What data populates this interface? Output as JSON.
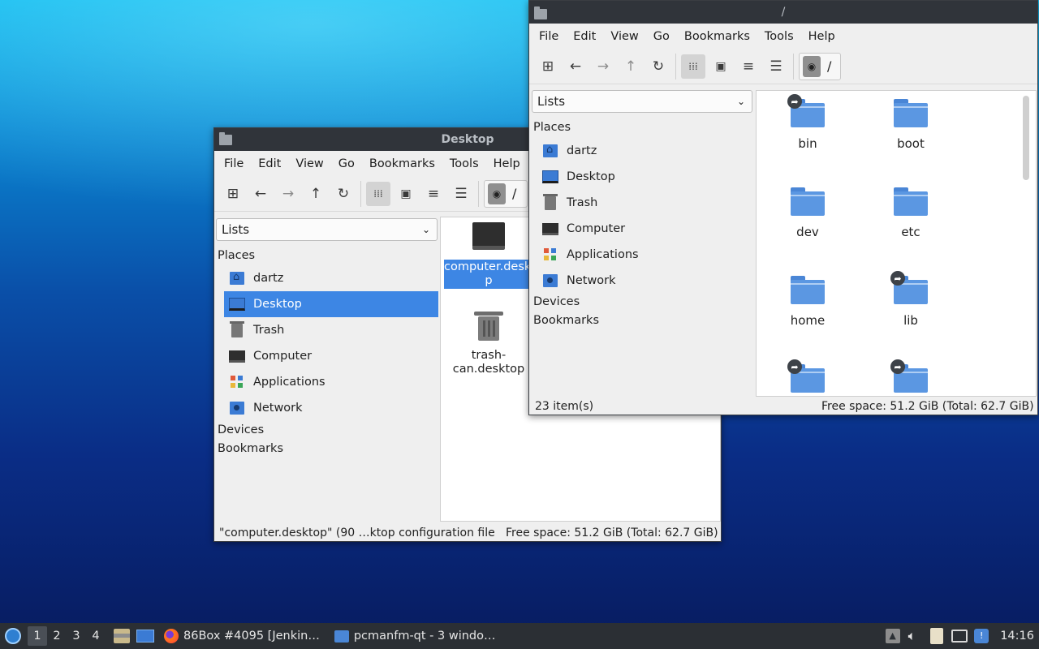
{
  "desktop_window": {
    "title": "Desktop",
    "menu": [
      "File",
      "Edit",
      "View",
      "Go",
      "Bookmarks",
      "Tools",
      "Help"
    ],
    "path": "/",
    "side_select": "Lists",
    "places_header": "Places",
    "places": [
      {
        "label": "dartz",
        "icon": "home-folder-icon"
      },
      {
        "label": "Desktop",
        "icon": "desktop-icon"
      },
      {
        "label": "Trash",
        "icon": "trash-icon"
      },
      {
        "label": "Computer",
        "icon": "computer-icon"
      },
      {
        "label": "Applications",
        "icon": "applications-icon"
      },
      {
        "label": "Network",
        "icon": "network-icon"
      }
    ],
    "devices_header": "Devices",
    "bookmarks_header": "Bookmarks",
    "files": [
      {
        "name_line1": "computer.deskto",
        "name_line2": "p",
        "selected": true
      },
      {
        "name_line1": "trash-",
        "name_line2": "can.desktop",
        "selected": false
      }
    ],
    "status_left": "\"computer.desktop\" (90 …ktop configuration file",
    "status_right": "Free space: 51.2 GiB (Total: 62.7 GiB)"
  },
  "root_window": {
    "title": "/",
    "menu": [
      "File",
      "Edit",
      "View",
      "Go",
      "Bookmarks",
      "Tools",
      "Help"
    ],
    "path": "/",
    "side_select": "Lists",
    "places_header": "Places",
    "places": [
      {
        "label": "dartz",
        "icon": "home-folder-icon"
      },
      {
        "label": "Desktop",
        "icon": "desktop-icon"
      },
      {
        "label": "Trash",
        "icon": "trash-icon"
      },
      {
        "label": "Computer",
        "icon": "computer-icon"
      },
      {
        "label": "Applications",
        "icon": "applications-icon"
      },
      {
        "label": "Network",
        "icon": "network-icon"
      }
    ],
    "devices_header": "Devices",
    "bookmarks_header": "Bookmarks",
    "folders": [
      {
        "name": "bin",
        "symlink": true
      },
      {
        "name": "boot",
        "symlink": false
      },
      {
        "name": "dev",
        "symlink": false
      },
      {
        "name": "etc",
        "symlink": false
      },
      {
        "name": "home",
        "symlink": false
      },
      {
        "name": "lib",
        "symlink": true
      },
      {
        "name": "",
        "symlink": true
      },
      {
        "name": "",
        "symlink": true
      }
    ],
    "status_left": "23 item(s)",
    "status_right": "Free space: 51.2 GiB (Total: 62.7 GiB)"
  },
  "taskbar": {
    "workspaces": [
      "1",
      "2",
      "3",
      "4"
    ],
    "active_workspace": "1",
    "tasks": [
      {
        "label": "86Box #4095 [Jenkin…",
        "icon": "firefox-icon"
      },
      {
        "label": "pcmanfm-qt - 3 windo…",
        "icon": "folder-icon"
      }
    ],
    "clock": "14:16"
  },
  "colors": {
    "selection": "#3d86e4",
    "titlebar": "#30343a",
    "folder": "#5b97e2",
    "taskbar": "#2b2f34"
  }
}
